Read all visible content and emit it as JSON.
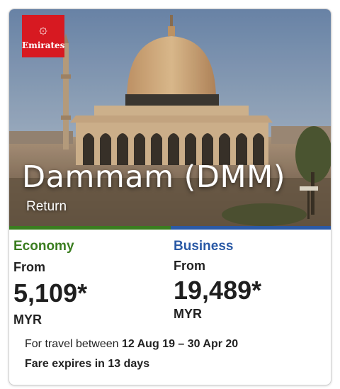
{
  "brand": {
    "name": "Emirates",
    "color": "#d71921"
  },
  "route": {
    "destination": "Dammam (DMM)",
    "trip_type": "Return"
  },
  "fares": [
    {
      "class_name": "Economy",
      "from_label": "From",
      "price": "5,109*",
      "currency": "MYR",
      "color": "#3a7d1f"
    },
    {
      "class_name": "Business",
      "from_label": "From",
      "price": "19,489*",
      "currency": "MYR",
      "color": "#2b5aa6"
    }
  ],
  "travel": {
    "prefix": "For travel between",
    "dates": "12 Aug 19 – 30 Apr 20"
  },
  "expiry": {
    "text": "Fare expires in 13 days"
  }
}
